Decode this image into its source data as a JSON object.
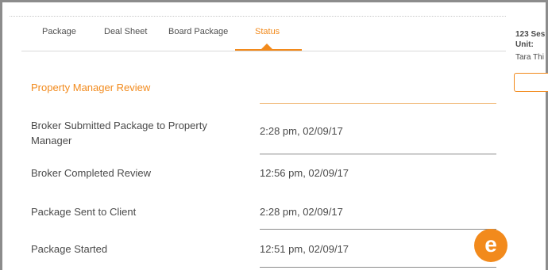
{
  "tabs": [
    {
      "label": "Package"
    },
    {
      "label": "Deal Sheet"
    },
    {
      "label": "Board Package"
    },
    {
      "label": "Status",
      "active": true
    }
  ],
  "side_panel": {
    "title": "123 Ses",
    "unit_label": "Unit:",
    "person": "Tara Thi"
  },
  "section": {
    "title": "Property Manager Review"
  },
  "rows": [
    {
      "label": "Broker Submitted Package to Property Manager",
      "value": "2:28 pm, 02/09/17"
    },
    {
      "label": "Broker Completed Review",
      "value": "12:56 pm, 02/09/17"
    },
    {
      "label": "Package Sent to Client",
      "value": "2:28 pm, 02/09/17"
    },
    {
      "label": "Package Started",
      "value": "12:51 pm, 02/09/17"
    }
  ],
  "badge": {
    "letter": "e",
    "color": "#f28a1c"
  },
  "colors": {
    "accent": "#f28a1c",
    "text": "#4a4a4a",
    "frame": "#8c8c8c"
  }
}
